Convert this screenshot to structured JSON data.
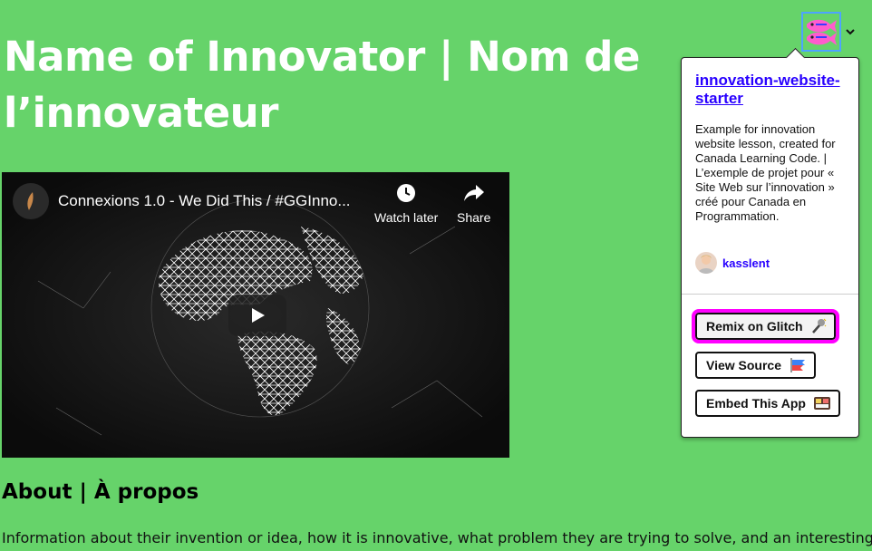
{
  "page": {
    "title": "Name of Innovator | Nom de l’innovateur",
    "about_heading": "About | À propos",
    "about_text": "Information about their invention or idea, how it is innovative, what problem they are trying to solve, and an interesting fact -"
  },
  "video": {
    "title": "Connexions 1.0 - We Did This / #GGInno...",
    "watch_later_label": "Watch later",
    "share_label": "Share"
  },
  "glitch": {
    "project_name": "innovation-website-starter",
    "description": "Example for innovation website lesson, created for Canada Learning Code. | L’exemple de projet pour « Site Web sur l’innovation » créé pour Canada en Programmation.",
    "author": "kasslent",
    "buttons": {
      "remix": "Remix on Glitch",
      "view_source": "View Source",
      "embed": "Embed This App"
    }
  },
  "colors": {
    "background": "#66d36a",
    "link": "#2800ff",
    "highlight": "#ff00ff"
  }
}
